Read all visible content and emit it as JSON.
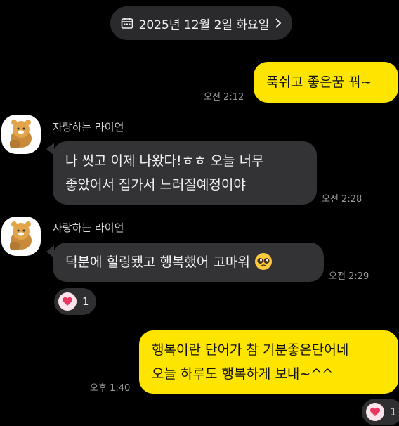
{
  "date_header": {
    "label": "2025년 12월 2일 화요일",
    "chevron": "chevron-right-icon",
    "calendar": "calendar-icon"
  },
  "messages": [
    {
      "sender": "me",
      "lines": [
        "푹쉬고 좋은꿈 꿔~"
      ],
      "time": "오전 2:12"
    },
    {
      "sender": "자랑하는 라이언",
      "lines": [
        "나 씻고 이제 나왔다!ㅎㅎ 오늘 너무",
        "좋았어서 집가서 느러질예정이야"
      ],
      "time": "오전 2:28"
    },
    {
      "sender": "자랑하는 라이언",
      "lines": [
        "덕분에 힐링됐고 행복했어 고마워"
      ],
      "emoji": "pleading-face",
      "time": "오전 2:29",
      "reaction_count": "1"
    },
    {
      "sender": "me",
      "lines": [
        "행복이란 단어가 참 기분좋은단어네",
        "오늘 하루도 행복하게 보내~^^"
      ],
      "time": "오후 1:40",
      "reaction_count": "1"
    }
  ],
  "colors": {
    "my_bubble": "#fee500",
    "their_bubble": "#333336",
    "heart": "#e8385f"
  }
}
